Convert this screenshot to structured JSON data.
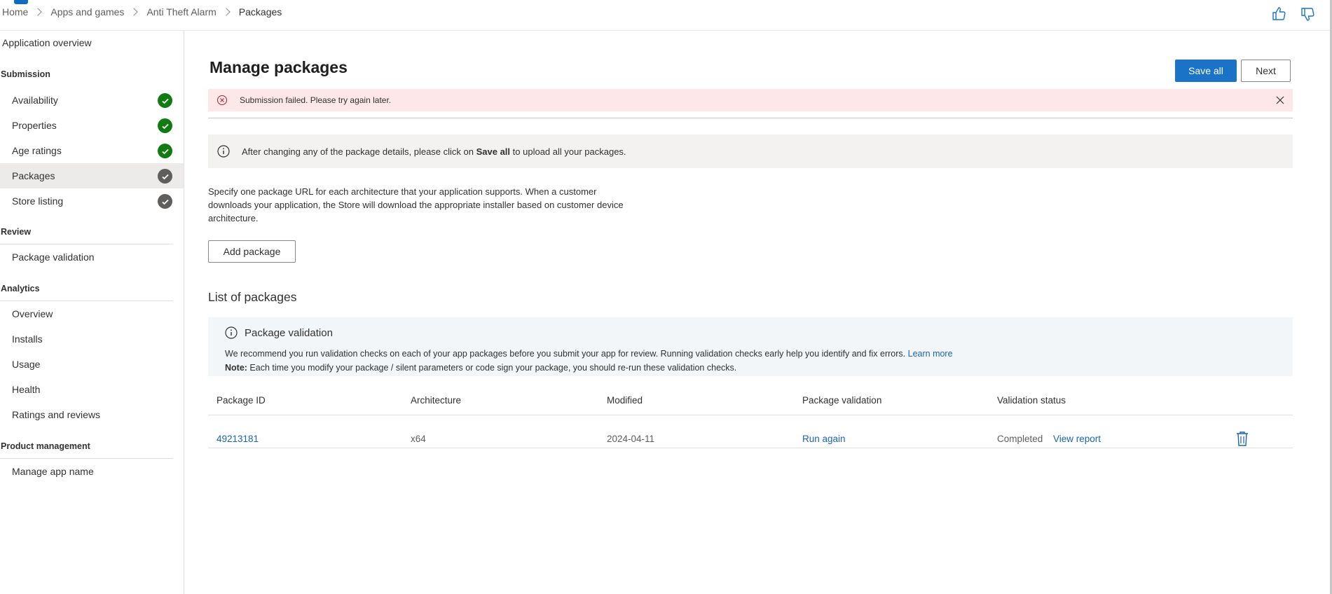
{
  "breadcrumb": {
    "items": [
      "Home",
      "Apps and games",
      "Anti Theft Alarm",
      "Packages"
    ]
  },
  "sidebar": {
    "overview": "Application overview",
    "sections": {
      "submission": "Submission",
      "review": "Review",
      "analytics": "Analytics",
      "product_management": "Product management"
    },
    "submission_items": [
      {
        "label": "Availability",
        "status": "complete"
      },
      {
        "label": "Properties",
        "status": "complete"
      },
      {
        "label": "Age ratings",
        "status": "complete"
      },
      {
        "label": "Packages",
        "status": "in-progress"
      },
      {
        "label": "Store listing",
        "status": "in-progress"
      }
    ],
    "review_items": [
      "Package validation"
    ],
    "analytics_items": [
      "Overview",
      "Installs",
      "Usage",
      "Health",
      "Ratings and reviews"
    ],
    "product_management_items": [
      "Manage app name"
    ]
  },
  "main": {
    "title": "Manage packages",
    "save_all": "Save all",
    "next": "Next",
    "error": "Submission failed. Please try again later.",
    "info": {
      "before": "After changing any of the package details, please click on ",
      "bold": "Save all",
      "after": " to upload all your packages."
    },
    "description": "Specify one package URL for each architecture that your application supports. When a customer downloads your application, the Store will download the appropriate installer based on customer device architecture.",
    "add_package": "Add package",
    "list_title": "List of packages",
    "validation_box": {
      "title": "Package validation",
      "line1": "We recommend you run validation checks on each of your app packages before you submit your app for review. Running validation checks early help you identify and fix errors.",
      "learn_more": "Learn more",
      "note_label": "Note:",
      "note_text": " Each time you modify your package / silent parameters or code sign your package, you should re-run these validation checks."
    },
    "table": {
      "headers": [
        "Package ID",
        "Architecture",
        "Modified",
        "Package validation",
        "Validation status"
      ],
      "rows": [
        {
          "package_id": "49213181",
          "architecture": "x64",
          "modified": "2024-04-11",
          "validation": "Run again",
          "status": "Completed",
          "view_report": "View report"
        }
      ]
    }
  },
  "colors": {
    "accent": "#1a73c7",
    "success": "#107c10",
    "error_bg": "#fde7e9"
  }
}
